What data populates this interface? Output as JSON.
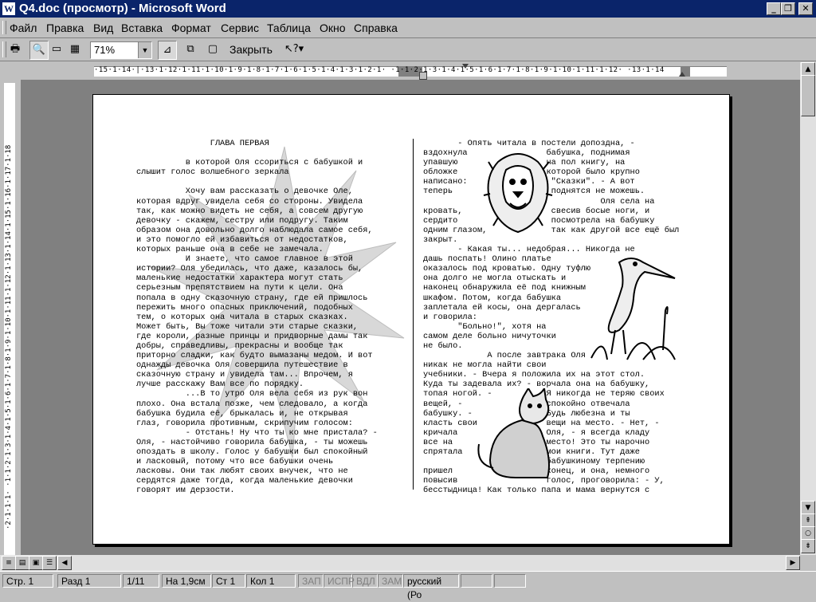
{
  "window": {
    "title": "Q4.doc (просмотр) - Microsoft Word",
    "app_icon": "W"
  },
  "menu": [
    "Файл",
    "Правка",
    "Вид",
    "Вставка",
    "Формат",
    "Сервис",
    "Таблица",
    "Окно",
    "Справка"
  ],
  "toolbar": {
    "zoom": "71%",
    "close_label": "Закрыть"
  },
  "ruler": {
    "numbers": "·15·1·14·|·13·1·12·1·11·1·10·1·9·1·8·1·7·1·6·1·5·1·4·1·3·1·2·1·   ·1·1·2·1·3·1·4·1·5·1·6·1·7·1·8·1·9·1·10·1·11·1·12·   ·13·1·14"
  },
  "vruler": {
    "numbers": "·2·1·1·1·  ·1·1·2·1·3·1·4·1·5·1·6·1·7·1·8·1·9·1·10·1·11·1·12·1·13·1·14·1·15·1·16·1·17·1·18"
  },
  "document": {
    "left_column": "               ГЛАВА ПЕРВАЯ\n\n          в которой Оля ссориться с бабушкой и\nслышит голос волшебного зеркала\n\n          Хочу вам рассказать о девочке Оле,\nкоторая вдруг увидела себя со стороны. Увидела\nтак, как можно видеть не себя, а совсем другую\nдевочку - скажем, сестру или подругу. Таким\nобразом она довольно долго наблюдала самое себя,\nи это помогло ей избавиться от недостатков,\nкоторых раньше она в себе не замечала.\n          И знаете, что самое главное в этой\nистории? Оля убедилась, что даже, казалось бы,\nмаленькие недостатки характера могут стать\nсерьезным препятствием на пути к цели. Она\nпопала в одну сказочную страну, где ей пришлось\nпережить много опасных приключений, подобных\nтем, о которых она читала в старых сказках.\nМожет быть, Вы тоже читали эти старые сказки,\nгде короли, разные принцы и придворные дамы так\nдобры, справедливы, прекрасны и вообще так\nприторно сладки, как будто вымазаны медом. И вот\nоднажды девочка Оля совершила путешествие в\nсказочную страну и увидела там... Впрочем, я\nлучше расскажу Вам все по порядку.\n          ...В то утро Оля вела себя из рук вон\nплохо. Она встала позже, чем следовало, а когда\nбабушка будила её, брыкалась и, не открывая\nглаз, говорила противным, скрипучим голосом:\n          - Отстань! Ну что ты ко мне пристала? -\nОля, - настойчиво говорила бабушка, - ты можешь\nопоздать в школу. Голос у бабушки был спокойный\nи ласковый, потому что все бабушки очень\nласковы. Они так любят своих внучек, что не\nсердятся даже тогда, когда маленькие девочки\nговорят им дерзости.",
    "right_column": "       - Опять читала в постели допоздна, -\nвздохнула                бабушка, поднимая\nупавшую                  на пол книгу, на\nобложке                  которой было крупно\nнаписано:                 \"Сказки\". - А вот\nтеперь                    поднятся не можешь.\n                                    Оля села на\nкровать,                  свесив босые ноги, и\nсердито                   посмотрела на бабушку\nодним глазом,             так как другой все ещё был\nзакрыт.\n       - Какая ты... недобрая... Никогда не\nдашь поспать! Олино платье\nоказалось под кроватью. Одну туфлю\nона долго не могла отыскать и\nнаконец обнаружила её под книжным\nшкафом. Потом, когда бабушка\nзаплетала ей косы, она дергалась\nи говорила:\n       \"Больно!\", хотя на\nсамом деле больно ничуточки\nне было.\n             А после завтрака Оля\nникак не могла найти свои\nучебники. - Вчера я положила их на этот стол.\nКуда ты задевала их? - ворчала она на бабушку,\nтопая ногой. -           Я никогда не теряю своих\nвещей, -                 спокойно отвечала\nбабушку. -               Будь любезна и ты\nкласть свои              вещи на место. - Нет, -\nкричала                  Оля, - я всегда кладу\nвсе на                   место! Это ты нарочно\nспрятала                 мои книги. Тут даже\n                         бабушкиному терпению\nпришел                   конец, и она, немного\nповысив                  голос, проговорила: - У,\nбесстыдница! Как только папа и мама вернутся с"
  },
  "status": {
    "page": "Стр. 1",
    "section": "Разд 1",
    "count": "1/11",
    "at": "На 1,9см",
    "line": "Ст 1",
    "col": "Кол 1",
    "rec": "ЗАП",
    "trk": "ИСПР",
    "ext": "ВДЛ",
    "ovr": "ЗАМ",
    "lang": "русский (Ро"
  }
}
